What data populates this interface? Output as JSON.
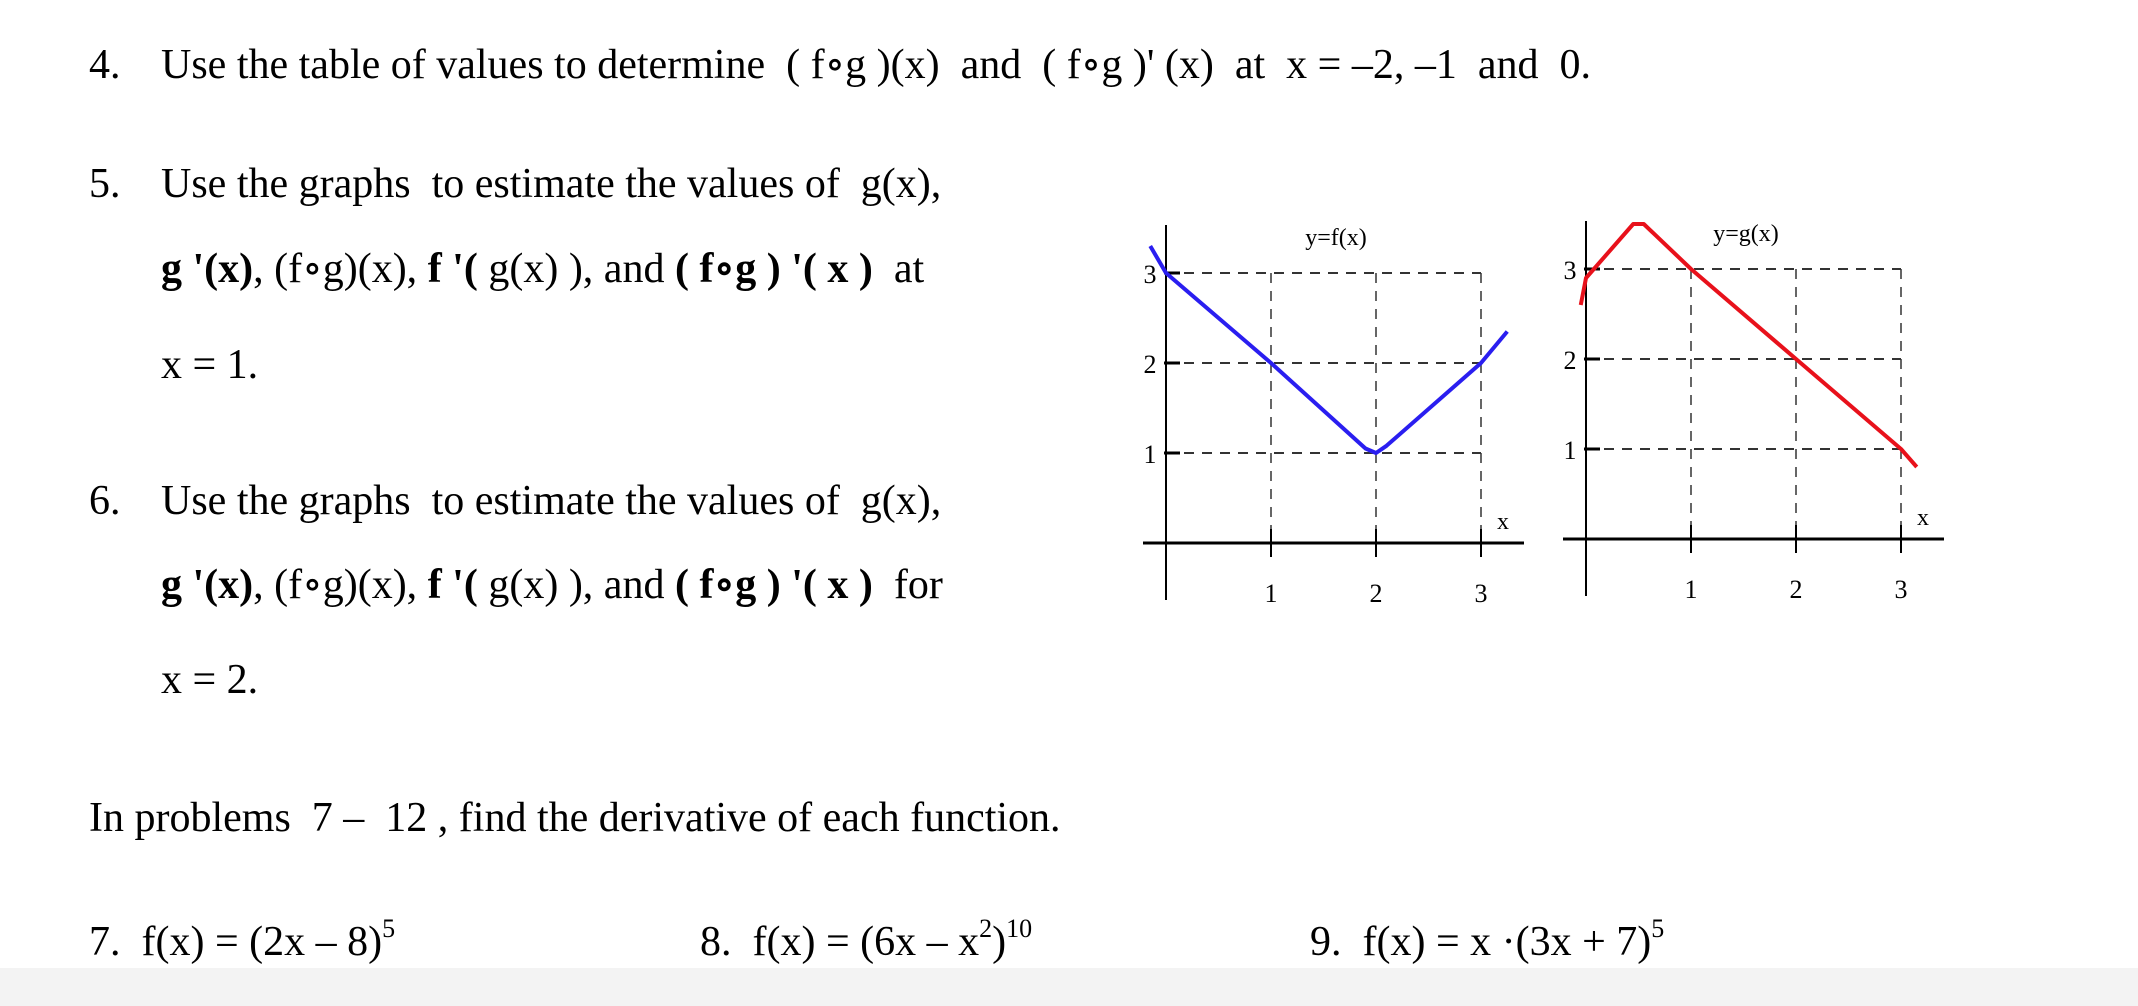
{
  "problems": [
    {
      "number": "4.",
      "top": 44,
      "segments": [
        {
          "t": "Use the table of values to determine  ( f∘g )(x)  and  ( f∘g )' (x)  at  x = –2, –1  and  0."
        }
      ]
    },
    {
      "number": "5.",
      "top": 163,
      "segments": [
        {
          "t": "Use the graphs  to estimate the values of  g(x),"
        }
      ]
    },
    {
      "number": "",
      "top": 248,
      "segments": [
        {
          "t": "g '(x)",
          "b": true
        },
        {
          "t": ", (f∘g)(x), "
        },
        {
          "t": "f '(",
          "b": true
        },
        {
          "t": " g(x) ), and "
        },
        {
          "t": "( f∘g ) '( x )",
          "b": true
        },
        {
          "t": "  at"
        }
      ]
    },
    {
      "number": "",
      "top": 344,
      "segments": [
        {
          "t": "x = 1."
        }
      ]
    },
    {
      "number": "6.",
      "top": 480,
      "segments": [
        {
          "t": "Use the graphs  to estimate the values of  g(x),"
        }
      ]
    },
    {
      "number": "",
      "top": 564,
      "segments": [
        {
          "t": "g '(x)",
          "b": true
        },
        {
          "t": ", (f∘g)(x), "
        },
        {
          "t": "f '(",
          "b": true
        },
        {
          "t": " g(x) ), and "
        },
        {
          "t": "( f∘g ) '( x )",
          "b": true
        },
        {
          "t": "  for"
        }
      ]
    },
    {
      "number": "",
      "top": 659,
      "segments": [
        {
          "t": "x = 2."
        }
      ]
    }
  ],
  "instructions": "In problems  7 –  12 , find the derivative of each function.",
  "exercises": [
    {
      "number": "7.",
      "expr": "f(x) = (2x – 8)",
      "exp": "5"
    },
    {
      "number": "8.",
      "expr": "f(x) = (6x – x",
      "inner_exp": "2",
      "close": ")",
      "exp": "10"
    },
    {
      "number": "9.",
      "expr": "f(x) = x ·(3x + 7)",
      "exp": "5"
    }
  ],
  "chart_data": [
    {
      "type": "line",
      "title": "y=f(x)",
      "xlabel": "x",
      "x_ticks": [
        "1",
        "2",
        "3"
      ],
      "y_ticks": [
        "1",
        "2",
        "3"
      ],
      "xlim": [
        0,
        3
      ],
      "ylim": [
        0,
        3
      ],
      "grid": "dashed",
      "color": "#2a1ef0",
      "points": [
        [
          -0.15,
          3.3
        ],
        [
          0,
          3
        ],
        [
          1,
          2
        ],
        [
          1.9,
          1.05
        ],
        [
          2,
          1
        ],
        [
          2.1,
          1.08
        ],
        [
          3,
          2
        ],
        [
          3.25,
          2.35
        ]
      ]
    },
    {
      "type": "line",
      "title": "y=g(x)",
      "xlabel": "x",
      "x_ticks": [
        "1",
        "2",
        "3"
      ],
      "y_ticks": [
        "1",
        "2",
        "3"
      ],
      "xlim": [
        0,
        3
      ],
      "ylim": [
        0,
        3
      ],
      "grid": "dashed",
      "color": "#e8111b",
      "points": [
        [
          -0.05,
          2.6
        ],
        [
          0,
          2.9
        ],
        [
          0.45,
          3.5
        ],
        [
          0.55,
          3.5
        ],
        [
          1,
          3
        ],
        [
          2,
          2
        ],
        [
          3,
          1
        ],
        [
          3.15,
          0.8
        ]
      ]
    }
  ]
}
